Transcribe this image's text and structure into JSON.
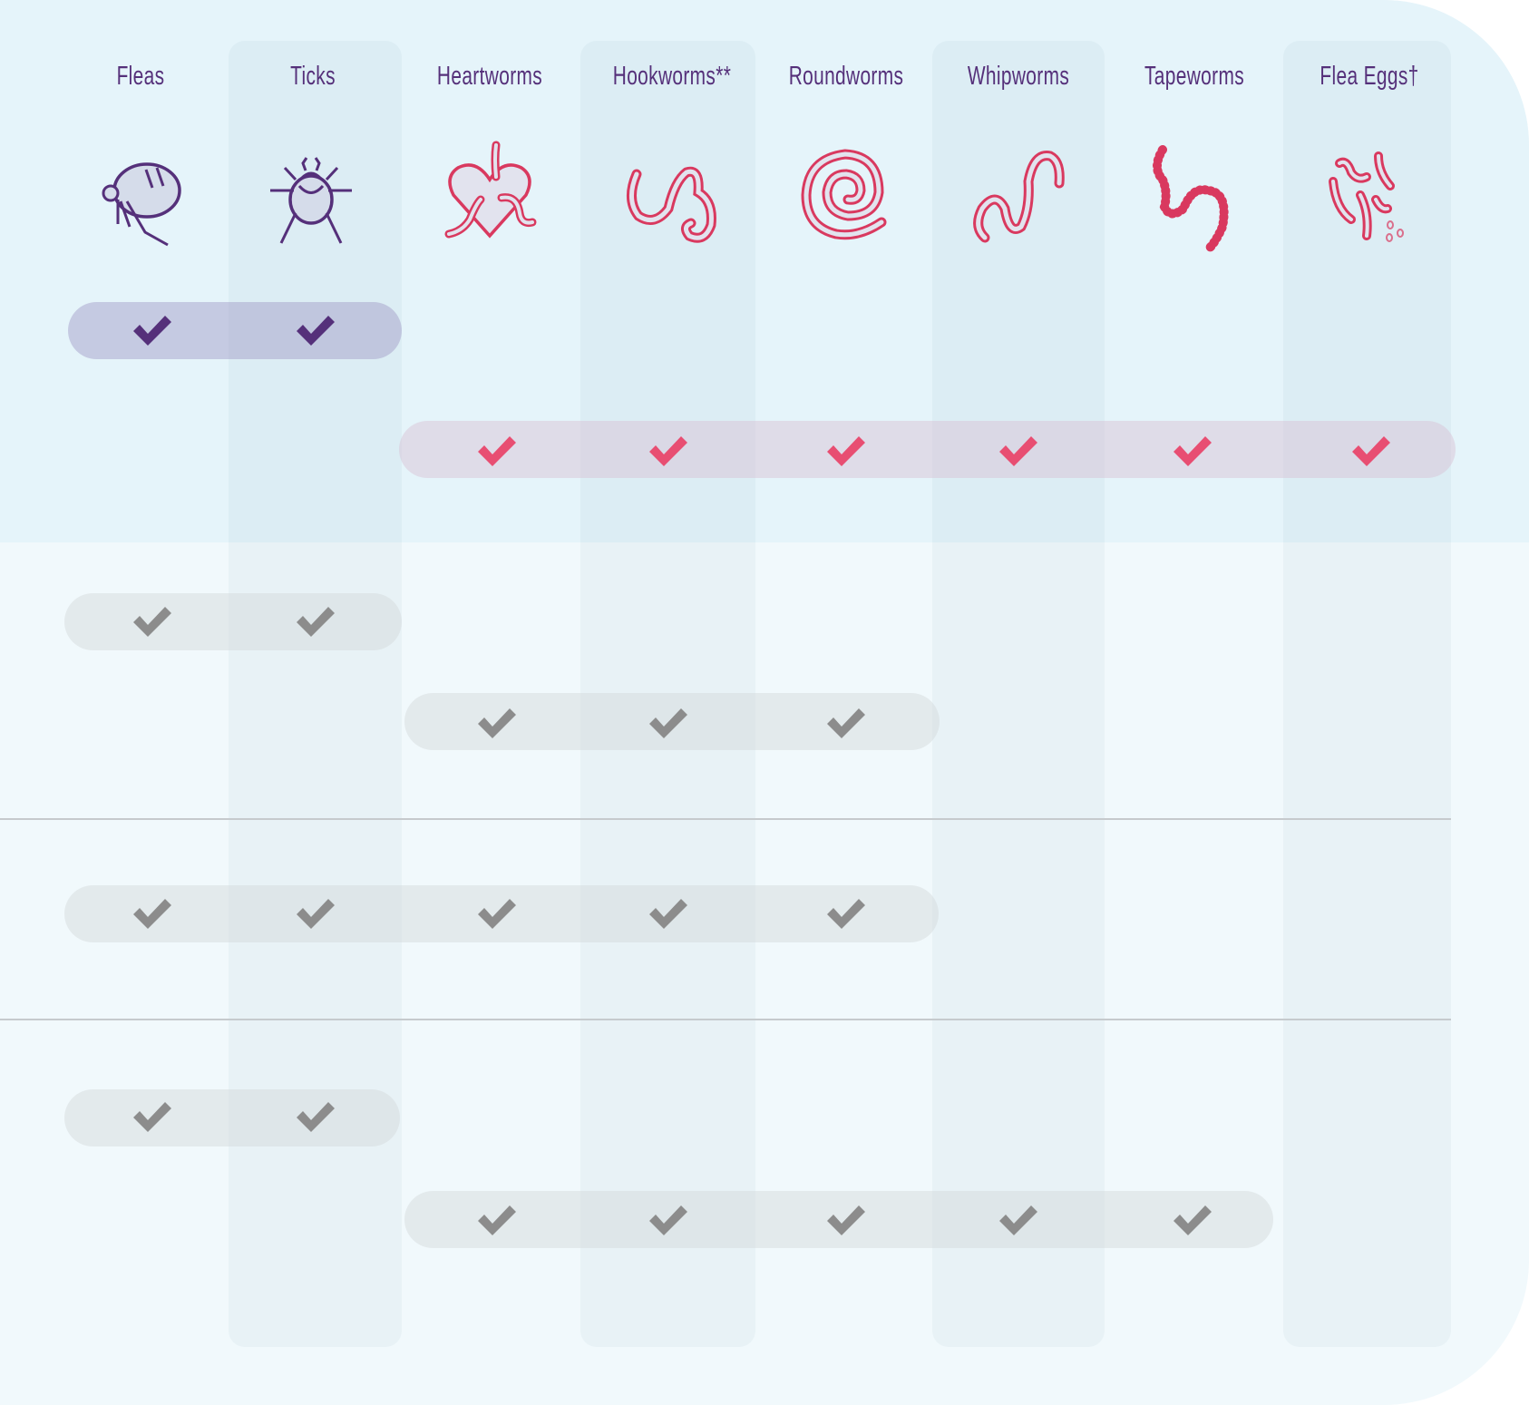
{
  "colors": {
    "label": "#55307a",
    "check_purple": "#55307a",
    "check_pink": "#e84e72",
    "check_grey": "#8c8c8c",
    "icon_purple": "#55307a",
    "icon_pink": "#d9395f"
  },
  "columns": [
    {
      "label": "Fleas",
      "icon": "flea-icon"
    },
    {
      "label": "Ticks",
      "icon": "tick-icon"
    },
    {
      "label": "Heartworms",
      "icon": "heartworm-icon"
    },
    {
      "label": "Hookworms**",
      "icon": "hookworm-icon"
    },
    {
      "label": "Roundworms",
      "icon": "roundworm-icon"
    },
    {
      "label": "Whipworms",
      "icon": "whipworm-icon"
    },
    {
      "label": "Tapeworms",
      "icon": "tapeworm-icon"
    },
    {
      "label": "Flea Eggs†",
      "icon": "flea-eggs-icon"
    }
  ],
  "rows": [
    {
      "style": "purple",
      "covered": [
        "Fleas",
        "Ticks"
      ]
    },
    {
      "style": "pink",
      "covered": [
        "Heartworms",
        "Hookworms**",
        "Roundworms",
        "Whipworms",
        "Tapeworms",
        "Flea Eggs†"
      ]
    },
    {
      "style": "grey",
      "covered": [
        "Fleas",
        "Ticks"
      ]
    },
    {
      "style": "grey",
      "covered": [
        "Heartworms",
        "Hookworms**",
        "Roundworms"
      ]
    },
    {
      "style": "grey",
      "covered": [
        "Fleas",
        "Ticks",
        "Heartworms",
        "Hookworms**",
        "Roundworms"
      ]
    },
    {
      "style": "grey",
      "covered": [
        "Fleas",
        "Ticks"
      ]
    },
    {
      "style": "grey",
      "covered": [
        "Heartworms",
        "Hookworms**",
        "Roundworms",
        "Whipworms",
        "Tapeworms"
      ]
    }
  ]
}
